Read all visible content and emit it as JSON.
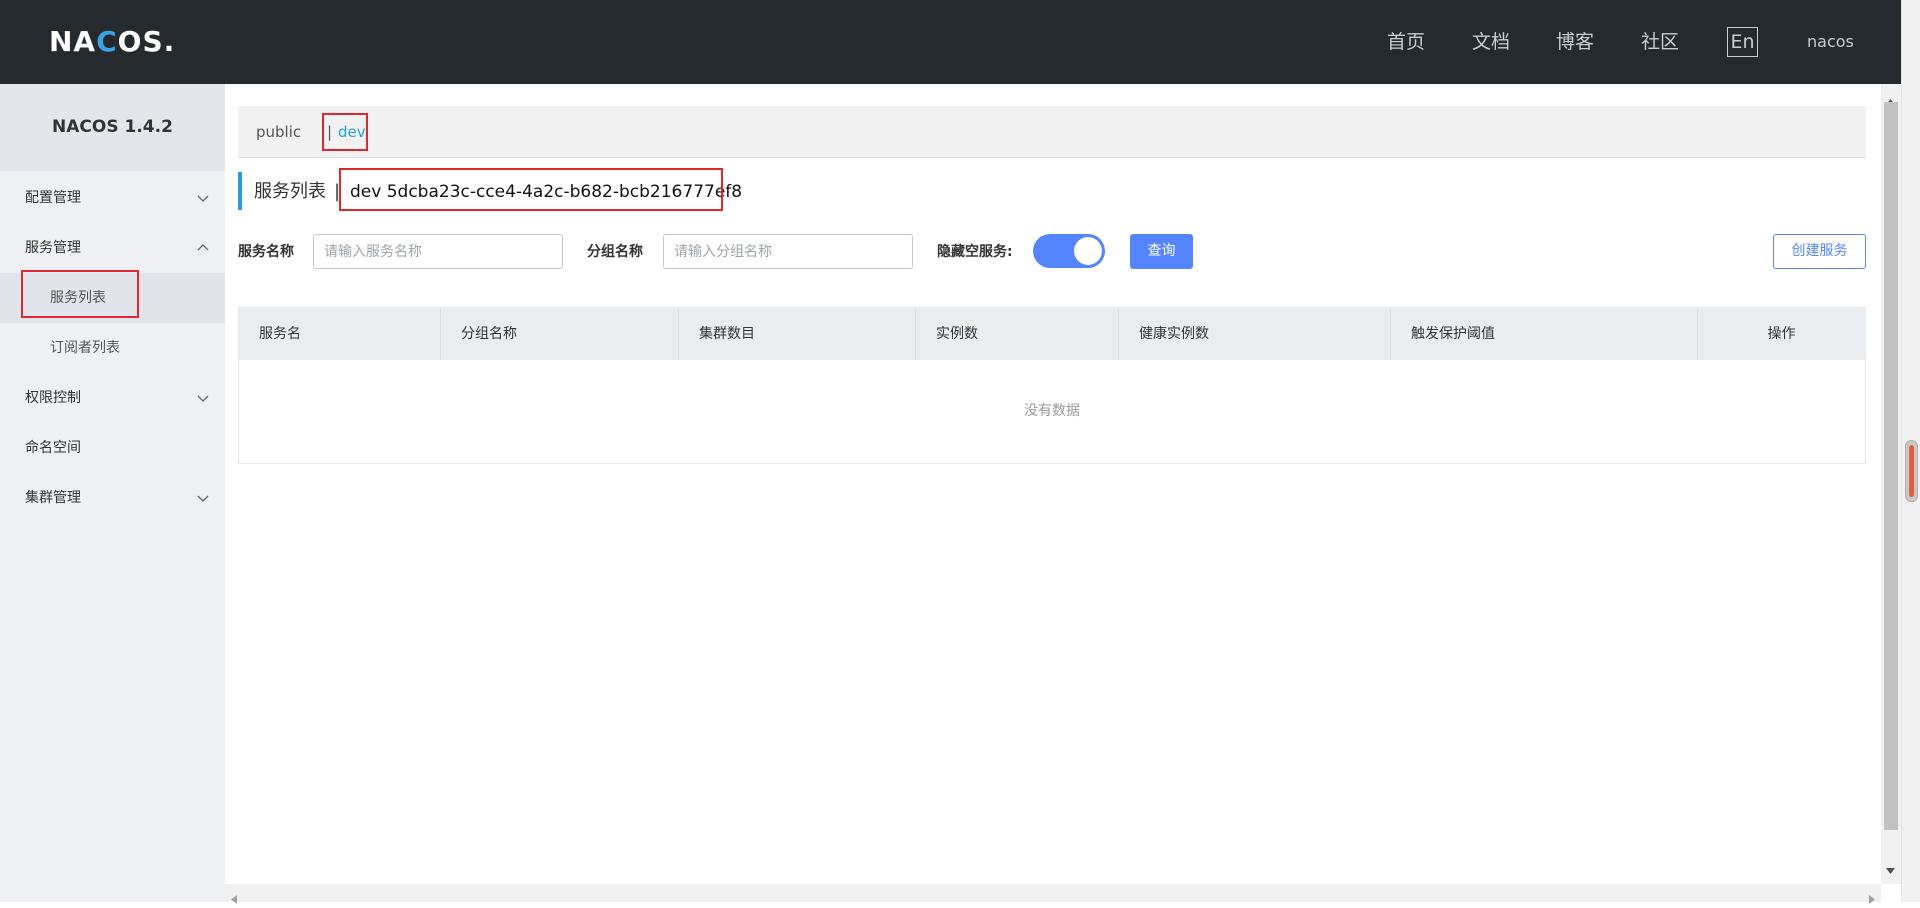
{
  "header": {
    "logo_text": "NACOS.",
    "nav": [
      "首页",
      "文档",
      "博客",
      "社区"
    ],
    "lang": "En",
    "user": "nacos"
  },
  "sidebar": {
    "brand": "NACOS 1.4.2",
    "items": [
      {
        "label": "配置管理",
        "expanded": false
      },
      {
        "label": "服务管理",
        "expanded": true
      },
      {
        "label": "服务列表",
        "active": true
      },
      {
        "label": "订阅者列表"
      },
      {
        "label": "权限控制",
        "expanded": false
      },
      {
        "label": "命名空间"
      },
      {
        "label": "集群管理",
        "expanded": false
      }
    ]
  },
  "namespace_bar": {
    "public": "public",
    "separator": "|",
    "dev": "dev"
  },
  "page_title": {
    "text": "服务列表",
    "separator": "|",
    "namespace": "dev  5dcba23c-cce4-4a2c-b682-bcb216777ef8"
  },
  "filters": {
    "service_name_label": "服务名称",
    "service_name_placeholder": "请输入服务名称",
    "group_name_label": "分组名称",
    "group_name_placeholder": "请输入分组名称",
    "hide_empty_label": "隐藏空服务:",
    "hide_empty_on": true,
    "query_button": "查询",
    "create_button": "创建服务"
  },
  "table": {
    "columns": [
      "服务名",
      "分组名称",
      "集群数目",
      "实例数",
      "健康实例数",
      "触发保护阈值",
      "操作"
    ],
    "rows": [],
    "empty_text": "没有数据"
  },
  "colors": {
    "header_bg": "#252a2f",
    "accent": "#5584ff",
    "link": "#2c9cdb",
    "highlight_box": "#e0272b"
  }
}
